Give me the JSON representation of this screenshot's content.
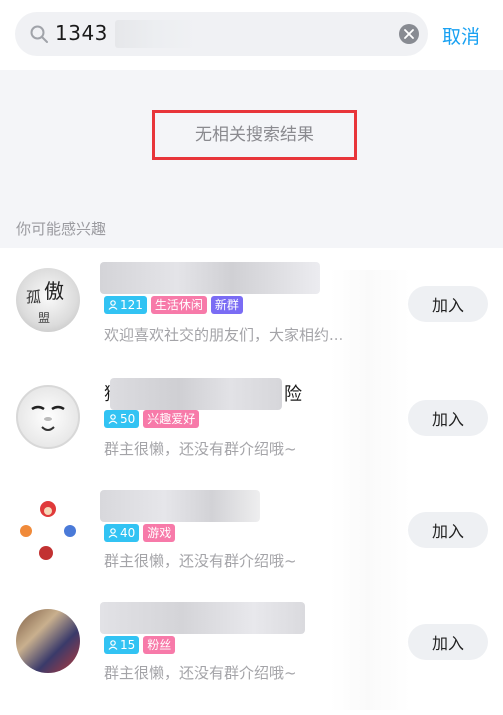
{
  "search": {
    "query": "1343",
    "cancel_label": "取消",
    "search_icon": "search-icon",
    "clear_icon": "clear-icon"
  },
  "results": {
    "empty_message": "无相关搜索结果"
  },
  "suggestions": {
    "header": "你可能感兴趣",
    "groups": [
      {
        "members": "121",
        "tags": [
          "生活休闲",
          "新群"
        ],
        "description": "欢迎喜欢社交的朋友们，大家相约...",
        "join_label": "加入"
      },
      {
        "name_suffix": "险",
        "name_prefix": "猴",
        "members": "50",
        "tags": [
          "兴趣爱好"
        ],
        "description": "群主很懒，还没有群介绍哦~",
        "join_label": "加入"
      },
      {
        "members": "40",
        "tags": [
          "游戏"
        ],
        "description": "群主很懒，还没有群介绍哦~",
        "join_label": "加入"
      },
      {
        "members": "15",
        "tags": [
          "粉丝"
        ],
        "description": "群主很懒，还没有群介绍哦~",
        "join_label": "加入"
      }
    ]
  },
  "colors": {
    "accent": "#19a1f2",
    "highlight_border": "#e8353a",
    "member_tag": "#32c3f3",
    "pink_tag": "#f77aa9",
    "purple_tag": "#7a6cf4"
  }
}
